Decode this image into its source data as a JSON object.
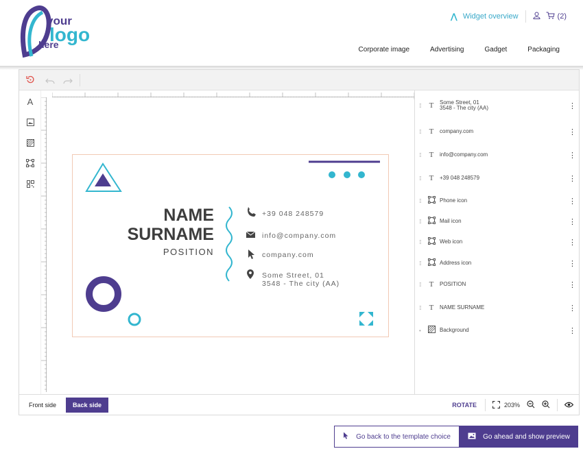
{
  "logo": {
    "text_top": "your",
    "text_mid": "logo",
    "text_bottom": "here"
  },
  "header": {
    "widget_overview": "Widget overview",
    "cart_count": "(2)",
    "nav": [
      "Corporate image",
      "Advertising",
      "Gadget",
      "Packaging"
    ]
  },
  "toolbar": {
    "icons": [
      "reset-icon",
      "undo-icon",
      "redo-icon"
    ]
  },
  "tools": [
    "text-icon",
    "image-icon",
    "background-icon",
    "shape-icon",
    "qr-icon"
  ],
  "card": {
    "name_line1": "NAME",
    "name_line2": "SURNAME",
    "position": "POSITION",
    "phone": "+39 048 248579",
    "email": "info@company.com",
    "web": "company.com",
    "address_line1": "Some Street, 01",
    "address_line2": "3548 - The city (AA)",
    "colors": {
      "primary": "#4e3d8f",
      "accent": "#33b6cf",
      "border": "#f1c9b4"
    }
  },
  "layers": [
    {
      "type": "T",
      "name_line1": "Some Street, 01",
      "name_line2": "3548 - The city (AA)"
    },
    {
      "type": "T",
      "name_line1": "company.com",
      "name_line2": ""
    },
    {
      "type": "T",
      "name_line1": "info@company.com",
      "name_line2": ""
    },
    {
      "type": "T",
      "name_line1": "+39 048 248579",
      "name_line2": ""
    },
    {
      "type": "shape",
      "name_line1": "Phone icon",
      "name_line2": ""
    },
    {
      "type": "shape",
      "name_line1": "Mail icon",
      "name_line2": ""
    },
    {
      "type": "shape",
      "name_line1": "Web icon",
      "name_line2": ""
    },
    {
      "type": "shape",
      "name_line1": "Address icon",
      "name_line2": ""
    },
    {
      "type": "T",
      "name_line1": "POSITION",
      "name_line2": ""
    },
    {
      "type": "T",
      "name_line1": "NAME SURNAME",
      "name_line2": ""
    },
    {
      "type": "bg",
      "name_line1": "Background",
      "name_line2": ""
    }
  ],
  "bottombar": {
    "front_side": "Front side",
    "back_side": "Back side",
    "rotate": "ROTATE",
    "zoom": "203%"
  },
  "footer": {
    "back_label": "Go back to the template choice",
    "ahead_label": "Go ahead and show preview"
  }
}
